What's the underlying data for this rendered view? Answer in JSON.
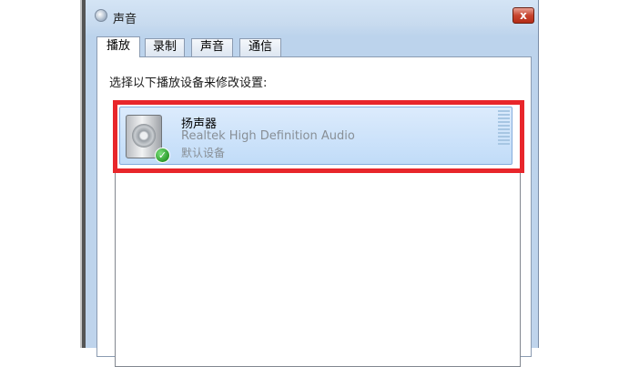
{
  "window": {
    "title": "声音",
    "close_label": "x"
  },
  "tabs": [
    {
      "label": "播放",
      "active": true
    },
    {
      "label": "录制",
      "active": false
    },
    {
      "label": "声音",
      "active": false
    },
    {
      "label": "通信",
      "active": false
    }
  ],
  "panel": {
    "instruction": "选择以下播放设备来修改设置:"
  },
  "devices": [
    {
      "name": "扬声器",
      "driver": "Realtek High Definition Audio",
      "status": "默认设备",
      "icon": "speaker-icon",
      "badge_icon": "check-icon"
    }
  ],
  "colors": {
    "highlight": "#e8262b",
    "selection": "#c1dcf8",
    "close_button": "#c7442e"
  }
}
